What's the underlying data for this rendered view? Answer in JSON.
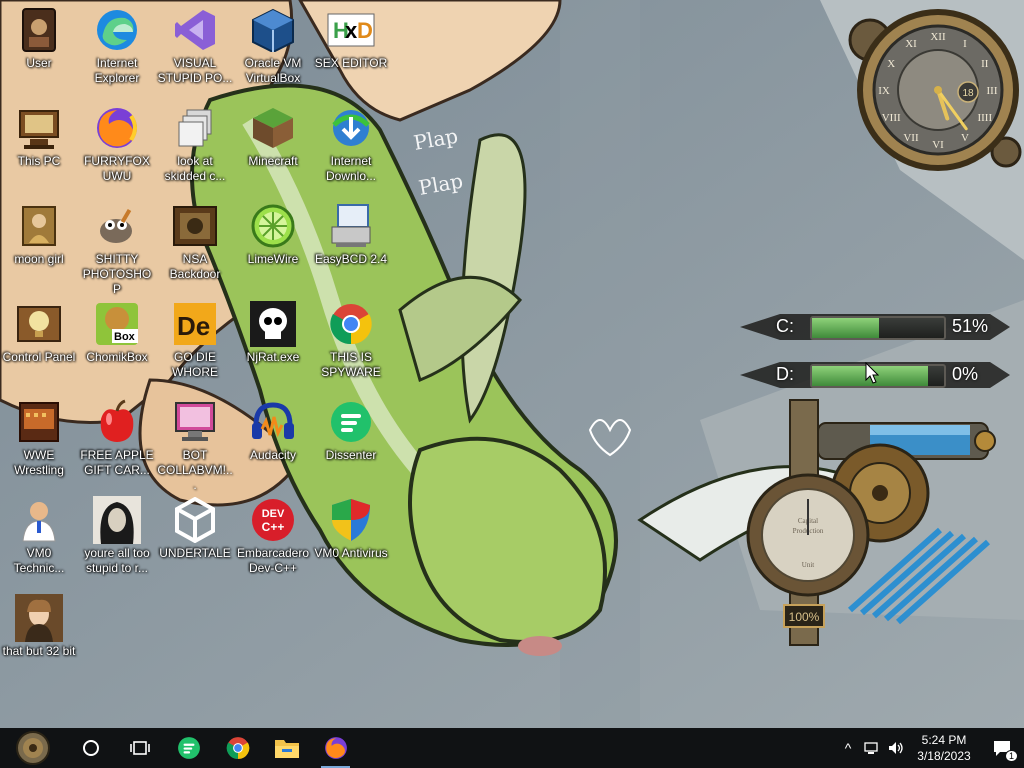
{
  "desktop": {
    "icons": [
      {
        "label": "User",
        "icon": "user-folder-icon"
      },
      {
        "label": "Internet Explorer",
        "icon": "edge-icon"
      },
      {
        "label": "VISUAL STUPID PO...",
        "icon": "visual-studio-icon"
      },
      {
        "label": "Oracle VM VirtualBox",
        "icon": "virtualbox-icon"
      },
      {
        "label": "SEX EDITOR",
        "icon": "hxd-icon"
      },
      {
        "label": "This PC",
        "icon": "this-pc-icon"
      },
      {
        "label": "FURRYFOX UWU",
        "icon": "firefox-icon"
      },
      {
        "label": "look at skidded c...",
        "icon": "shortcut-stack-icon"
      },
      {
        "label": "Minecraft",
        "icon": "minecraft-icon"
      },
      {
        "label": "Internet Downlo...",
        "icon": "idm-icon"
      },
      {
        "label": "moon girl",
        "icon": "moon-girl-icon"
      },
      {
        "label": "SHITTY PHOTOSHOP",
        "icon": "gimp-icon"
      },
      {
        "label": "NSA Backdoor",
        "icon": "nsa-backdoor-icon"
      },
      {
        "label": "LimeWire",
        "icon": "limewire-icon"
      },
      {
        "label": "EasyBCD 2.4",
        "icon": "easybcd-icon"
      },
      {
        "label": "Control Panel",
        "icon": "control-panel-icon"
      },
      {
        "label": "ChomikBox",
        "icon": "chomikbox-icon"
      },
      {
        "label": "GO DIE WHORE",
        "icon": "de-app-icon"
      },
      {
        "label": "NjRat.exe",
        "icon": "skull-icon"
      },
      {
        "label": "THIS IS SPYWARE",
        "icon": "chrome-icon"
      },
      {
        "label": "WWE Wrestling",
        "icon": "wwe-icon"
      },
      {
        "label": "FREE APPLE GIFT CAR...",
        "icon": "apple-icon"
      },
      {
        "label": "BOT COLLABVM!...",
        "icon": "bot-monitor-icon"
      },
      {
        "label": "Audacity",
        "icon": "audacity-icon"
      },
      {
        "label": "Dissenter",
        "icon": "dissenter-icon"
      },
      {
        "label": "VM0 Technic...",
        "icon": "technician-icon"
      },
      {
        "label": "youre all too stupid to r...",
        "icon": "portrait-icon"
      },
      {
        "label": "UNDERTALE",
        "icon": "unity-icon"
      },
      {
        "label": "Embarcadero Dev-C++",
        "icon": "devcpp-icon"
      },
      {
        "label": "VM0 Antivirus",
        "icon": "shield-icon"
      },
      {
        "label": "that but 32 bit",
        "icon": "portrait-lady-icon"
      }
    ]
  },
  "clock_gadget": {
    "numerals": [
      "XII",
      "I",
      "II",
      "III",
      "IIII",
      "V",
      "VI",
      "VII",
      "VIII",
      "IX",
      "X",
      "XI"
    ],
    "date_dial": "18",
    "hour": 5,
    "minute": 24
  },
  "drives": [
    {
      "label": "C:",
      "percent_text": "51%",
      "fill": 0.51
    },
    {
      "label": "D:",
      "percent_text": "0%",
      "fill": 0.88
    }
  ],
  "gauge": {
    "label": "100%",
    "dial_lines": [
      "Capital",
      "Production",
      "Unit"
    ]
  },
  "taskbar": {
    "items": [
      {
        "name": "start",
        "icon": "steampunk-start-icon"
      },
      {
        "name": "search",
        "icon": "search-circle-icon"
      },
      {
        "name": "task-view",
        "icon": "task-view-icon"
      },
      {
        "name": "dissenter",
        "icon": "dissenter-icon"
      },
      {
        "name": "chrome",
        "icon": "chrome-icon"
      },
      {
        "name": "file-explorer",
        "icon": "folder-icon"
      },
      {
        "name": "firefox",
        "icon": "firefox-icon",
        "active": true
      }
    ],
    "time": "5:24 PM",
    "date": "3/18/2023",
    "notification_count": "1"
  },
  "colors": {
    "taskbar": "#101214",
    "dragon_green": "#9bc45a",
    "wallpaper_gray": "#8d9aa3",
    "drive_fill": "#5fae52"
  }
}
